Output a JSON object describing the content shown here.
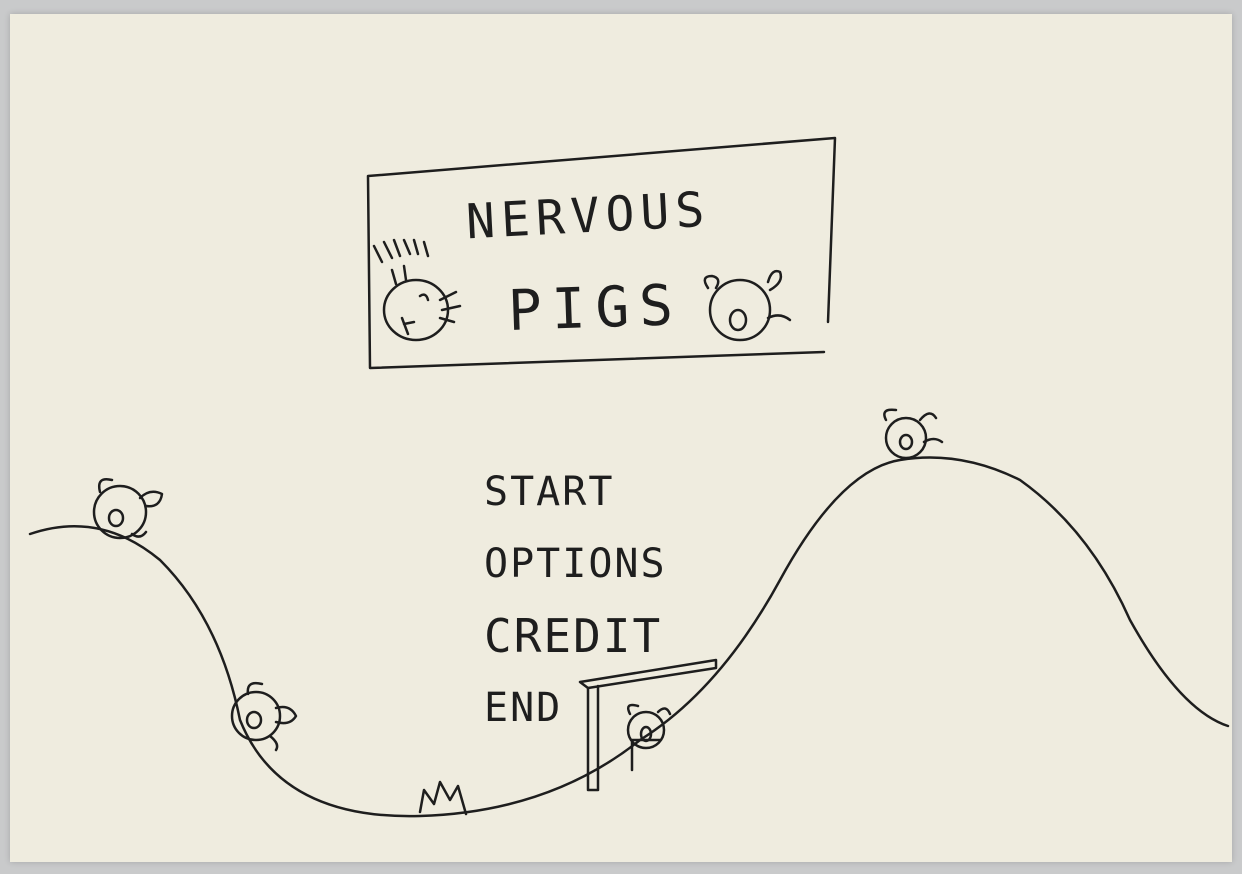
{
  "title": {
    "line1": "NERVOUS",
    "line2": "PIGS"
  },
  "menu": {
    "items": [
      {
        "label": "START"
      },
      {
        "label": "OPTIONS"
      },
      {
        "label": "CREDIT"
      },
      {
        "label": "END"
      }
    ]
  },
  "colors": {
    "paper": "#efecdf",
    "ink": "#1e1e1e",
    "background": "#c9cacb"
  },
  "sprites": [
    "pig-character",
    "bird-character",
    "fire-hazard",
    "shelter-structure",
    "hill-terrain"
  ]
}
